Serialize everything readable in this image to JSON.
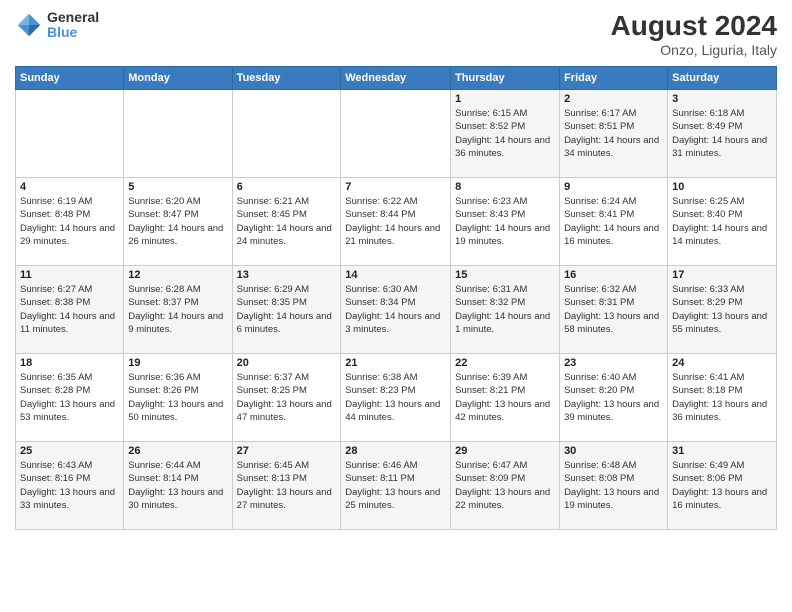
{
  "header": {
    "logo_text_top": "General",
    "logo_text_bottom": "Blue",
    "title": "August 2024",
    "subtitle": "Onzo, Liguria, Italy"
  },
  "weekdays": [
    "Sunday",
    "Monday",
    "Tuesday",
    "Wednesday",
    "Thursday",
    "Friday",
    "Saturday"
  ],
  "weeks": [
    [
      {
        "day": "",
        "info": ""
      },
      {
        "day": "",
        "info": ""
      },
      {
        "day": "",
        "info": ""
      },
      {
        "day": "",
        "info": ""
      },
      {
        "day": "1",
        "info": "Sunrise: 6:15 AM\nSunset: 8:52 PM\nDaylight: 14 hours and 36 minutes."
      },
      {
        "day": "2",
        "info": "Sunrise: 6:17 AM\nSunset: 8:51 PM\nDaylight: 14 hours and 34 minutes."
      },
      {
        "day": "3",
        "info": "Sunrise: 6:18 AM\nSunset: 8:49 PM\nDaylight: 14 hours and 31 minutes."
      }
    ],
    [
      {
        "day": "4",
        "info": "Sunrise: 6:19 AM\nSunset: 8:48 PM\nDaylight: 14 hours and 29 minutes."
      },
      {
        "day": "5",
        "info": "Sunrise: 6:20 AM\nSunset: 8:47 PM\nDaylight: 14 hours and 26 minutes."
      },
      {
        "day": "6",
        "info": "Sunrise: 6:21 AM\nSunset: 8:45 PM\nDaylight: 14 hours and 24 minutes."
      },
      {
        "day": "7",
        "info": "Sunrise: 6:22 AM\nSunset: 8:44 PM\nDaylight: 14 hours and 21 minutes."
      },
      {
        "day": "8",
        "info": "Sunrise: 6:23 AM\nSunset: 8:43 PM\nDaylight: 14 hours and 19 minutes."
      },
      {
        "day": "9",
        "info": "Sunrise: 6:24 AM\nSunset: 8:41 PM\nDaylight: 14 hours and 16 minutes."
      },
      {
        "day": "10",
        "info": "Sunrise: 6:25 AM\nSunset: 8:40 PM\nDaylight: 14 hours and 14 minutes."
      }
    ],
    [
      {
        "day": "11",
        "info": "Sunrise: 6:27 AM\nSunset: 8:38 PM\nDaylight: 14 hours and 11 minutes."
      },
      {
        "day": "12",
        "info": "Sunrise: 6:28 AM\nSunset: 8:37 PM\nDaylight: 14 hours and 9 minutes."
      },
      {
        "day": "13",
        "info": "Sunrise: 6:29 AM\nSunset: 8:35 PM\nDaylight: 14 hours and 6 minutes."
      },
      {
        "day": "14",
        "info": "Sunrise: 6:30 AM\nSunset: 8:34 PM\nDaylight: 14 hours and 3 minutes."
      },
      {
        "day": "15",
        "info": "Sunrise: 6:31 AM\nSunset: 8:32 PM\nDaylight: 14 hours and 1 minute."
      },
      {
        "day": "16",
        "info": "Sunrise: 6:32 AM\nSunset: 8:31 PM\nDaylight: 13 hours and 58 minutes."
      },
      {
        "day": "17",
        "info": "Sunrise: 6:33 AM\nSunset: 8:29 PM\nDaylight: 13 hours and 55 minutes."
      }
    ],
    [
      {
        "day": "18",
        "info": "Sunrise: 6:35 AM\nSunset: 8:28 PM\nDaylight: 13 hours and 53 minutes."
      },
      {
        "day": "19",
        "info": "Sunrise: 6:36 AM\nSunset: 8:26 PM\nDaylight: 13 hours and 50 minutes."
      },
      {
        "day": "20",
        "info": "Sunrise: 6:37 AM\nSunset: 8:25 PM\nDaylight: 13 hours and 47 minutes."
      },
      {
        "day": "21",
        "info": "Sunrise: 6:38 AM\nSunset: 8:23 PM\nDaylight: 13 hours and 44 minutes."
      },
      {
        "day": "22",
        "info": "Sunrise: 6:39 AM\nSunset: 8:21 PM\nDaylight: 13 hours and 42 minutes."
      },
      {
        "day": "23",
        "info": "Sunrise: 6:40 AM\nSunset: 8:20 PM\nDaylight: 13 hours and 39 minutes."
      },
      {
        "day": "24",
        "info": "Sunrise: 6:41 AM\nSunset: 8:18 PM\nDaylight: 13 hours and 36 minutes."
      }
    ],
    [
      {
        "day": "25",
        "info": "Sunrise: 6:43 AM\nSunset: 8:16 PM\nDaylight: 13 hours and 33 minutes."
      },
      {
        "day": "26",
        "info": "Sunrise: 6:44 AM\nSunset: 8:14 PM\nDaylight: 13 hours and 30 minutes."
      },
      {
        "day": "27",
        "info": "Sunrise: 6:45 AM\nSunset: 8:13 PM\nDaylight: 13 hours and 27 minutes."
      },
      {
        "day": "28",
        "info": "Sunrise: 6:46 AM\nSunset: 8:11 PM\nDaylight: 13 hours and 25 minutes."
      },
      {
        "day": "29",
        "info": "Sunrise: 6:47 AM\nSunset: 8:09 PM\nDaylight: 13 hours and 22 minutes."
      },
      {
        "day": "30",
        "info": "Sunrise: 6:48 AM\nSunset: 8:08 PM\nDaylight: 13 hours and 19 minutes."
      },
      {
        "day": "31",
        "info": "Sunrise: 6:49 AM\nSunset: 8:06 PM\nDaylight: 13 hours and 16 minutes."
      }
    ]
  ]
}
